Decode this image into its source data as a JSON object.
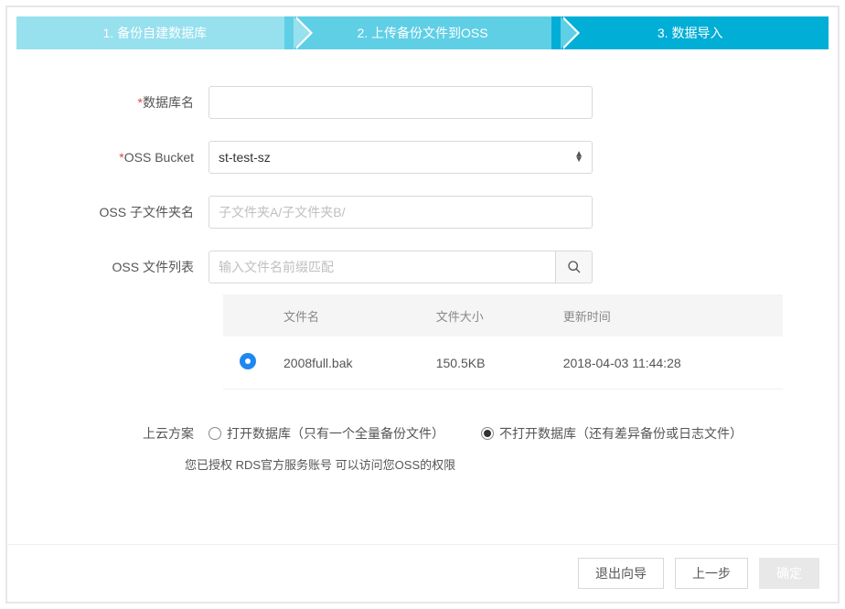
{
  "stepper": {
    "step1": "1. 备份自建数据库",
    "step2": "2. 上传备份文件到OSS",
    "step3": "3. 数据导入"
  },
  "form": {
    "db_name_label": "数据库名",
    "db_name_value": "",
    "oss_bucket_label": "OSS Bucket",
    "oss_bucket_value": "st-test-sz",
    "subfolder_label": "OSS 子文件夹名",
    "subfolder_placeholder": "子文件夹A/子文件夹B/",
    "subfolder_value": "",
    "filelist_label": "OSS 文件列表",
    "filelist_placeholder": "输入文件名前缀匹配",
    "filelist_value": ""
  },
  "table": {
    "head_name": "文件名",
    "head_size": "文件大小",
    "head_time": "更新时间",
    "rows": [
      {
        "name": "2008full.bak",
        "size": "150.5KB",
        "time": "2018-04-03 11:44:28"
      }
    ]
  },
  "plan": {
    "label": "上云方案",
    "opt1": "打开数据库（只有一个全量备份文件）",
    "opt2": "不打开数据库（还有差异备份或日志文件）"
  },
  "auth_text": "您已授权 RDS官方服务账号 可以访问您OSS的权限",
  "footer": {
    "exit": "退出向导",
    "prev": "上一步",
    "ok": "确定"
  }
}
